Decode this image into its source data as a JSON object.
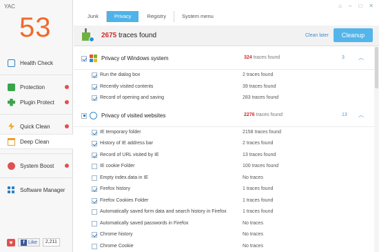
{
  "app": {
    "title": "YAC",
    "score": "53"
  },
  "window": {
    "minimize": "–",
    "maximize": "□",
    "close": "✕",
    "pin": "⌂"
  },
  "sidebar": {
    "items": [
      {
        "label": "Health Check",
        "dot": false
      },
      {
        "label": "Protection",
        "dot": true
      },
      {
        "label": "Plugin Protect",
        "dot": true
      },
      {
        "label": "Quick Clean",
        "dot": true
      },
      {
        "label": "Deep Clean",
        "dot": false
      },
      {
        "label": "System Boost",
        "dot": true
      },
      {
        "label": "Software Manager",
        "dot": false
      }
    ]
  },
  "social": {
    "like": "Like",
    "count": "2,211"
  },
  "tabs": [
    "Junk",
    "Privacy",
    "Registry",
    "System menu"
  ],
  "active_tab": "Privacy",
  "header": {
    "count": "2675",
    "count_suffix": " traces found",
    "clean_later": "Clean later",
    "cleanup": "Cleanup"
  },
  "sections": [
    {
      "title": "Privacy of Windows system",
      "count": "324",
      "count_suffix": " traces found",
      "num": "3",
      "items": [
        {
          "label": "Run the dialog box",
          "value": "2 traces found",
          "checked": true
        },
        {
          "label": "Recently visited contents",
          "value": "39 traces found",
          "checked": true
        },
        {
          "label": "Record of opening and saving",
          "value": "283 traces found",
          "checked": true
        }
      ]
    },
    {
      "title": "Privacy of visited websites",
      "count": "2276",
      "count_suffix": " traces found",
      "num": "13",
      "items": [
        {
          "label": "IE temporary folder",
          "value": "2158 traces found",
          "checked": true
        },
        {
          "label": "History of IE address bar",
          "value": "2 traces found",
          "checked": true
        },
        {
          "label": "Record of URL visited by IE",
          "value": "13 traces found",
          "checked": true
        },
        {
          "label": "IE cookie Folder",
          "value": "100 traces found",
          "checked": false
        },
        {
          "label": "Empty index.data in IE",
          "value": "No traces",
          "checked": false
        },
        {
          "label": "Firefox history",
          "value": "1 traces found",
          "checked": true
        },
        {
          "label": "Firefox Cookies Folder",
          "value": "1 traces found",
          "checked": true
        },
        {
          "label": "Automatically saved form data and search history in Firefox",
          "value": "1 traces found",
          "checked": false
        },
        {
          "label": "Automatically saved passwords in Firefox",
          "value": "No traces",
          "checked": false
        },
        {
          "label": "Chrome history",
          "value": "No traces",
          "checked": true
        },
        {
          "label": "Chrome Cookie",
          "value": "No traces",
          "checked": false
        }
      ]
    }
  ]
}
